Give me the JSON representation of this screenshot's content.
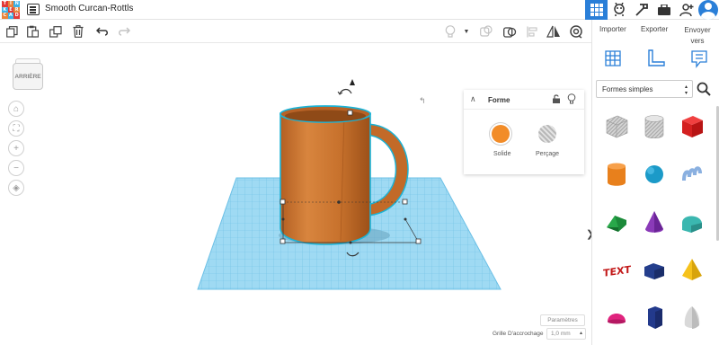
{
  "app": {
    "title": "Smooth Curcan-Rottls",
    "logo_letters": [
      "T",
      "I",
      "N",
      "K",
      "E",
      "R",
      "C",
      "A",
      "D"
    ]
  },
  "toolbar": {
    "copy_icon": "copy-icon",
    "paste_icon": "paste-icon",
    "duplicate_icon": "duplicate-icon",
    "delete_icon": "trash-icon",
    "undo_icon": "undo-icon",
    "redo_icon": "redo-icon"
  },
  "right_panel": {
    "import_label": "Importer",
    "export_label": "Exporter",
    "send_label": "Envoyer vers",
    "category": "Formes simples"
  },
  "viewcube": {
    "face_label": "ARRIÈRE"
  },
  "inspector": {
    "title": "Forme",
    "solid_label": "Solide",
    "hole_label": "Perçage",
    "solid_color": "#f28c28"
  },
  "footer": {
    "params_label": "Paramètres",
    "grid_label": "Grille D'accrochage",
    "grid_value": "1,0 mm"
  },
  "colors": {
    "accent": "#2a7fd8",
    "workplane": "#8fd3f0",
    "mug": "#c86e2a"
  }
}
